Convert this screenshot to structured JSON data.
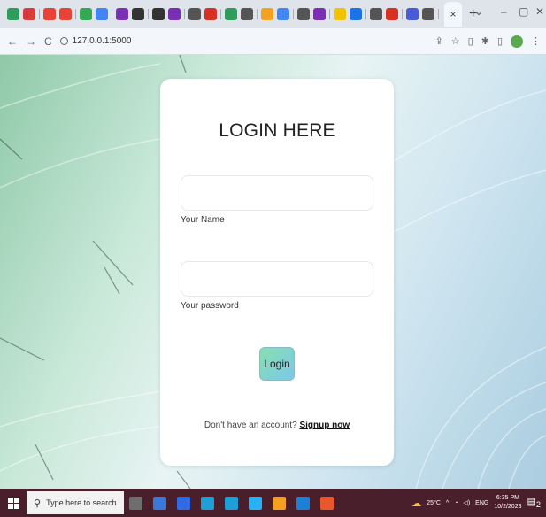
{
  "browser": {
    "tab_icons": [
      "#2e9d5b",
      "#d83b3b",
      "#ea4335",
      "#ea4335",
      "#34a853",
      "#4285f4",
      "#7b2fb4",
      "#333333",
      "#333333",
      "#7b2fb4",
      "#555555",
      "#d93025",
      "#2e9d5b",
      "#555555",
      "#f4a020",
      "#4285f4",
      "#555555",
      "#7b2fb4",
      "#f2c200",
      "#1a73e8",
      "#555555",
      "#d93025",
      "#4a5bd9",
      "#555555"
    ],
    "active_tab_close": "×",
    "new_tab": "+",
    "window_controls": [
      "⌄",
      "–",
      "▢",
      "✕"
    ],
    "url": "127.0.0.1:5000",
    "nav": {
      "back": "←",
      "forward": "→",
      "reload": "C"
    }
  },
  "login_card": {
    "title": "LOGIN HERE",
    "name_label": "Your Name",
    "name_value": "",
    "password_label": "Your password",
    "password_value": "",
    "login_button": "Login",
    "signup_prompt": "Don't have an account?",
    "signup_link": "Signup now"
  },
  "taskbar": {
    "search_placeholder": "Type here to search",
    "weather": "25°C",
    "language": "ENG",
    "time": "6:35 PM",
    "date": "10/2/2023",
    "notification_count": "2",
    "app_icons": [
      "#6e6e6e",
      "#3b78d8",
      "#2e6ce6",
      "#1e9fd8",
      "#1e9fd8",
      "#2ab0f5",
      "#f4a020",
      "#1e7fd6",
      "#e8572e"
    ]
  }
}
